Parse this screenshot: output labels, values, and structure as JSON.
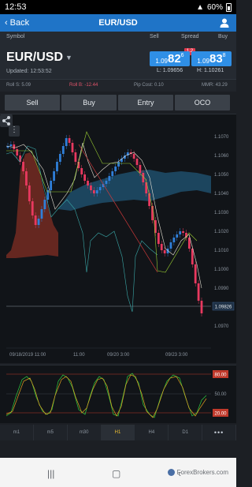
{
  "status_bar": {
    "time": "12:53",
    "battery": "60%"
  },
  "nav": {
    "back_label": "Back",
    "title": "EUR/USD"
  },
  "columns": {
    "symbol": "Symbol",
    "sell": "Sell",
    "spread": "Spread",
    "buy": "Buy"
  },
  "quote": {
    "pair": "EUR/USD",
    "updated": "Updated: 12:53:52",
    "spread": "1.2",
    "sell": {
      "prefix": "1.09",
      "big": "82",
      "pip": "6"
    },
    "buy": {
      "prefix": "1.09",
      "big": "83",
      "pip": "8"
    },
    "low": "L: 1.09656",
    "high": "H: 1.10261"
  },
  "stats": {
    "roll_s": "Roll S: 5.09",
    "roll_b": "Roll B: -12.44",
    "pip_cost": "Pip Cost: 0.10",
    "mmr": "MMR: 43.29"
  },
  "actions": [
    "Sell",
    "Buy",
    "Entry",
    "OCO"
  ],
  "chart_axis": {
    "y_ticks": [
      "1.1070",
      "1.1060",
      "1.1050",
      "1.1040",
      "1.1030",
      "1.1020",
      "1.1010",
      "1.1000",
      "1.0990",
      "1.0980",
      "1.0970"
    ],
    "current_price": "1.09826",
    "x_ticks": [
      "09/18/2019 11:00",
      "11:00",
      "09/20 3:00",
      "09/23 3:00"
    ]
  },
  "oscillator": {
    "upper": "80.00",
    "mid": "50.00",
    "lower": "20.00"
  },
  "timeframes": [
    "m1",
    "m5",
    "m30",
    "H1",
    "H4",
    "D1",
    "•••"
  ],
  "active_timeframe": "H1",
  "watermark": "ForexBrokers.com",
  "colors": {
    "accent": "#1f74c7",
    "price_box": "#2f8fe6",
    "bull": "#2f7fd9",
    "bear": "#e8395f",
    "active_tf": "#f1c232"
  }
}
